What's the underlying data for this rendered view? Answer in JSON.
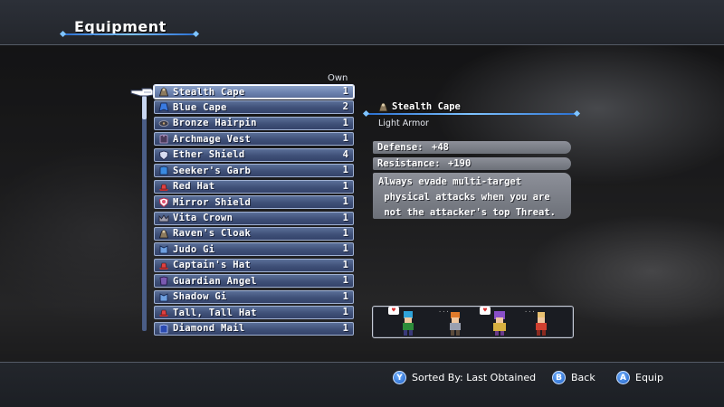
{
  "header": {
    "title": "Equipment"
  },
  "list": {
    "own_label": "Own",
    "items": [
      {
        "name": "Stealth Cape",
        "count": "1",
        "icon": "cloak-icon",
        "selected": true
      },
      {
        "name": "Blue Cape",
        "count": "2",
        "icon": "cape-icon"
      },
      {
        "name": "Bronze Hairpin",
        "count": "1",
        "icon": "hairpin-icon"
      },
      {
        "name": "Archmage Vest",
        "count": "1",
        "icon": "vest-icon"
      },
      {
        "name": "Ether Shield",
        "count": "4",
        "icon": "shield-icon"
      },
      {
        "name": "Seeker's Garb",
        "count": "1",
        "icon": "garb-icon"
      },
      {
        "name": "Red Hat",
        "count": "1",
        "icon": "hat-icon"
      },
      {
        "name": "Mirror Shield",
        "count": "1",
        "icon": "mirror-shield-icon"
      },
      {
        "name": "Vita Crown",
        "count": "1",
        "icon": "crown-icon"
      },
      {
        "name": "Raven's Cloak",
        "count": "1",
        "icon": "cloak-icon"
      },
      {
        "name": "Judo Gi",
        "count": "1",
        "icon": "gi-icon"
      },
      {
        "name": "Captain's Hat",
        "count": "1",
        "icon": "hat-icon"
      },
      {
        "name": "Guardian Angel",
        "count": "1",
        "icon": "armor-icon"
      },
      {
        "name": "Shadow Gi",
        "count": "1",
        "icon": "gi-icon"
      },
      {
        "name": "Tall, Tall Hat",
        "count": "1",
        "icon": "hat-icon"
      },
      {
        "name": "Diamond Mail",
        "count": "1",
        "icon": "mail-icon"
      }
    ]
  },
  "detail": {
    "name": "Stealth Cape",
    "category": "Light Armor",
    "defense_label": "Defense:",
    "defense_value": "+48",
    "resistance_label": "Resistance:",
    "resistance_value": "+190",
    "description_lines": [
      "Always evade multi-target",
      " physical attacks when you are",
      " not the attacker's top Threat."
    ]
  },
  "party": [
    {
      "name": "party-member-1",
      "can_equip": true
    },
    {
      "name": "party-member-2",
      "can_equip": false
    },
    {
      "name": "party-member-3",
      "can_equip": true
    },
    {
      "name": "party-member-4",
      "can_equip": false
    }
  ],
  "footer": {
    "sort_button": "Y",
    "sort_label": "Sorted By: Last Obtained",
    "back_button": "B",
    "back_label": "Back",
    "equip_button": "A",
    "equip_label": "Equip"
  },
  "colors": {
    "accent_blue": "#7fc4ff",
    "row_fill": "#3f5078",
    "stat_fill": "#7c8088"
  }
}
